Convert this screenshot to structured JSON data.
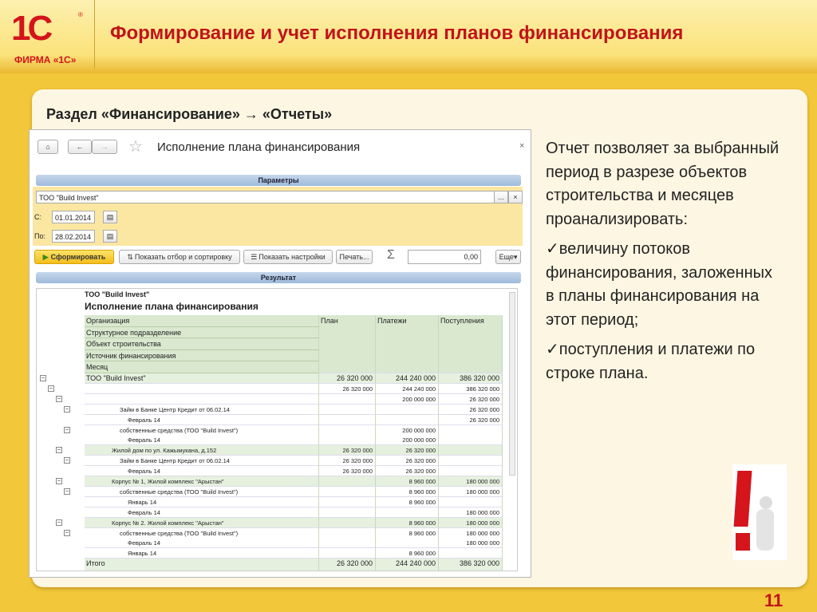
{
  "header": {
    "logo_text": "1С",
    "logo_caption": "ФИРМА «1С»",
    "title": "Формирование и учет исполнения планов финансирования"
  },
  "section": "Раздел «Финансирование» → «Отчеты»",
  "window": {
    "title": "Исполнение плана финансирования",
    "close": "×",
    "params_label": "Параметры",
    "org_value": "ТОО \"Build Invest\"",
    "org_select": "...",
    "org_clear": "×",
    "from_label": "С:",
    "from_value": "01.01.2014",
    "to_label": "По:",
    "to_value": "28.02.2014",
    "generate": "Сформировать",
    "show_filter": "Показать отбор и сортировку",
    "show_settings": "Показать настройки",
    "print": "Печать...",
    "sigma": "Σ",
    "sum_value": "0,00",
    "more": "Еще",
    "result_label": "Результат"
  },
  "report": {
    "org": "ТОО \"Build Invest\"",
    "title": "Исполнение плана финансирования",
    "group_headers": [
      "Организация",
      "Структурное подразделение",
      "Объект строительства",
      "Источник финансирования",
      "Месяц"
    ],
    "columns": [
      "План",
      "Платежи",
      "Поступления"
    ],
    "rows": [
      {
        "label": "ТОО \"Build Invest\"",
        "level": 0,
        "g": 1,
        "v": [
          "26 320 000",
          "244 240 000",
          "386 320 000"
        ]
      },
      {
        "label": "",
        "level": 1,
        "v": [
          "26 320 000",
          "244 240 000",
          "386 320 000"
        ]
      },
      {
        "label": "",
        "level": 2,
        "v": [
          "",
          "200 000 000",
          "26 320 000"
        ]
      },
      {
        "label": "Займ в Банке Центр Кредит от 06.02.14",
        "level": 3,
        "v": [
          "",
          "",
          "26 320 000"
        ]
      },
      {
        "label": "Февраль 14",
        "level": 4,
        "v": [
          "",
          "",
          "26 320 000"
        ]
      },
      {
        "label": "собственные средства (ТОО \"Build Invest\")",
        "level": 3,
        "v": [
          "",
          "200 000 000",
          ""
        ]
      },
      {
        "label": "Февраль 14",
        "level": 4,
        "v": [
          "",
          "200 000 000",
          ""
        ]
      },
      {
        "label": "Жилой дом по ул. Кажымукана, д.152",
        "level": 2,
        "g": 1,
        "v": [
          "26 320 000",
          "26 320 000",
          ""
        ]
      },
      {
        "label": "Займ в Банке Центр Кредит от 06.02.14",
        "level": 3,
        "v": [
          "26 320 000",
          "26 320 000",
          ""
        ]
      },
      {
        "label": "Февраль 14",
        "level": 4,
        "v": [
          "26 320 000",
          "26 320 000",
          ""
        ]
      },
      {
        "label": "Корпус № 1, Жилой комплекс \"Арыстан\"",
        "level": 2,
        "g": 1,
        "v": [
          "",
          "8 960 000",
          "180 000 000"
        ]
      },
      {
        "label": "собственные средства (ТОО \"Build Invest\")",
        "level": 3,
        "v": [
          "",
          "8 960 000",
          "180 000 000"
        ]
      },
      {
        "label": "Январь 14",
        "level": 4,
        "v": [
          "",
          "8 960 000",
          ""
        ]
      },
      {
        "label": "Февраль 14",
        "level": 4,
        "v": [
          "",
          "",
          "180 000 000"
        ]
      },
      {
        "label": "Корпус № 2. Жилой комплекс \"Арыстан\"",
        "level": 2,
        "g": 1,
        "v": [
          "",
          "8 960 000",
          "180 000 000"
        ]
      },
      {
        "label": "собственные средства (ТОО \"Build Invest\")",
        "level": 3,
        "v": [
          "",
          "8 960 000",
          "180 000 000"
        ]
      },
      {
        "label": "Февраль 14",
        "level": 4,
        "v": [
          "",
          "",
          "180 000 000"
        ]
      },
      {
        "label": "Январь 14",
        "level": 4,
        "v": [
          "",
          "8 960 000",
          ""
        ]
      }
    ],
    "total": {
      "label": "Итого",
      "v": [
        "26 320 000",
        "244 240 000",
        "386 320 000"
      ]
    }
  },
  "description": {
    "intro": "Отчет позволяет за выбранный период в разрезе объектов строительства и месяцев проанализировать:",
    "bullets": [
      "✓величину потоков финансирования, заложенных в планы финансирования на этот период;",
      "✓поступления и платежи по строке плана."
    ]
  },
  "page_number": "11"
}
